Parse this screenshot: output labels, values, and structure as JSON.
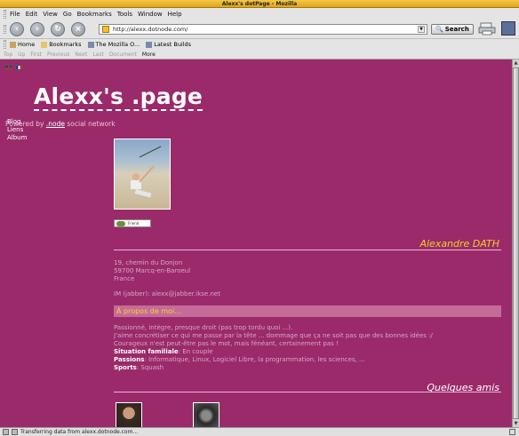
{
  "window": {
    "title": "Alexx's dotPage - Mozilla"
  },
  "menu": {
    "items": [
      "File",
      "Edit",
      "View",
      "Go",
      "Bookmarks",
      "Tools",
      "Window",
      "Help"
    ]
  },
  "navigation": {
    "url": "http://alexx.dotnode.com/",
    "search_label": "Search"
  },
  "bookmarks": {
    "items": [
      "Home",
      "Bookmarks",
      "The Mozilla O...",
      "Latest Builds"
    ]
  },
  "site_navigation": {
    "items": [
      "Top",
      "Up",
      "First",
      "Previous",
      "Next",
      "Last",
      "Document",
      "More"
    ]
  },
  "page": {
    "title": "Alexx's .page",
    "powered_prefix": "Powered by",
    "powered_link": ".node",
    "powered_suffix": "social network",
    "side_menu": [
      "Blog",
      "Liens",
      "Album"
    ],
    "badge_text": "Friend",
    "name": "Alexandre DATH",
    "address": [
      "19, chemin du Donjon",
      "59700 Marcq-en-Baroeul",
      "France"
    ],
    "im": "IM (jabber): alexx@jabber.ikse.net",
    "about_heading": "À propos de moi...",
    "about_lines": [
      "Passionné, intègre, presque droit (pas trop tordu quoi ...).",
      "J'aime concrétiser ce qui me passe par la tête ... dommage que ça ne soit pas que des bonnes idées :/",
      "Courageux n'est peut-être pas le mot, mais fénéant, certainement pas !"
    ],
    "facts": [
      {
        "label": "Situation familiale",
        "value": ": En couple"
      },
      {
        "label": "Passions",
        "value": ": Informatique, Linux, Logiciel Libre, la programmation, les sciences, ..."
      },
      {
        "label": "Sports",
        "value": ": Squash"
      }
    ],
    "friends_heading": "Quelques amis"
  },
  "status": {
    "text": "Transferring data from alexx.dotnode.com..."
  },
  "colors": {
    "background": "#9b2a6b",
    "accent": "#f4cf1e"
  }
}
